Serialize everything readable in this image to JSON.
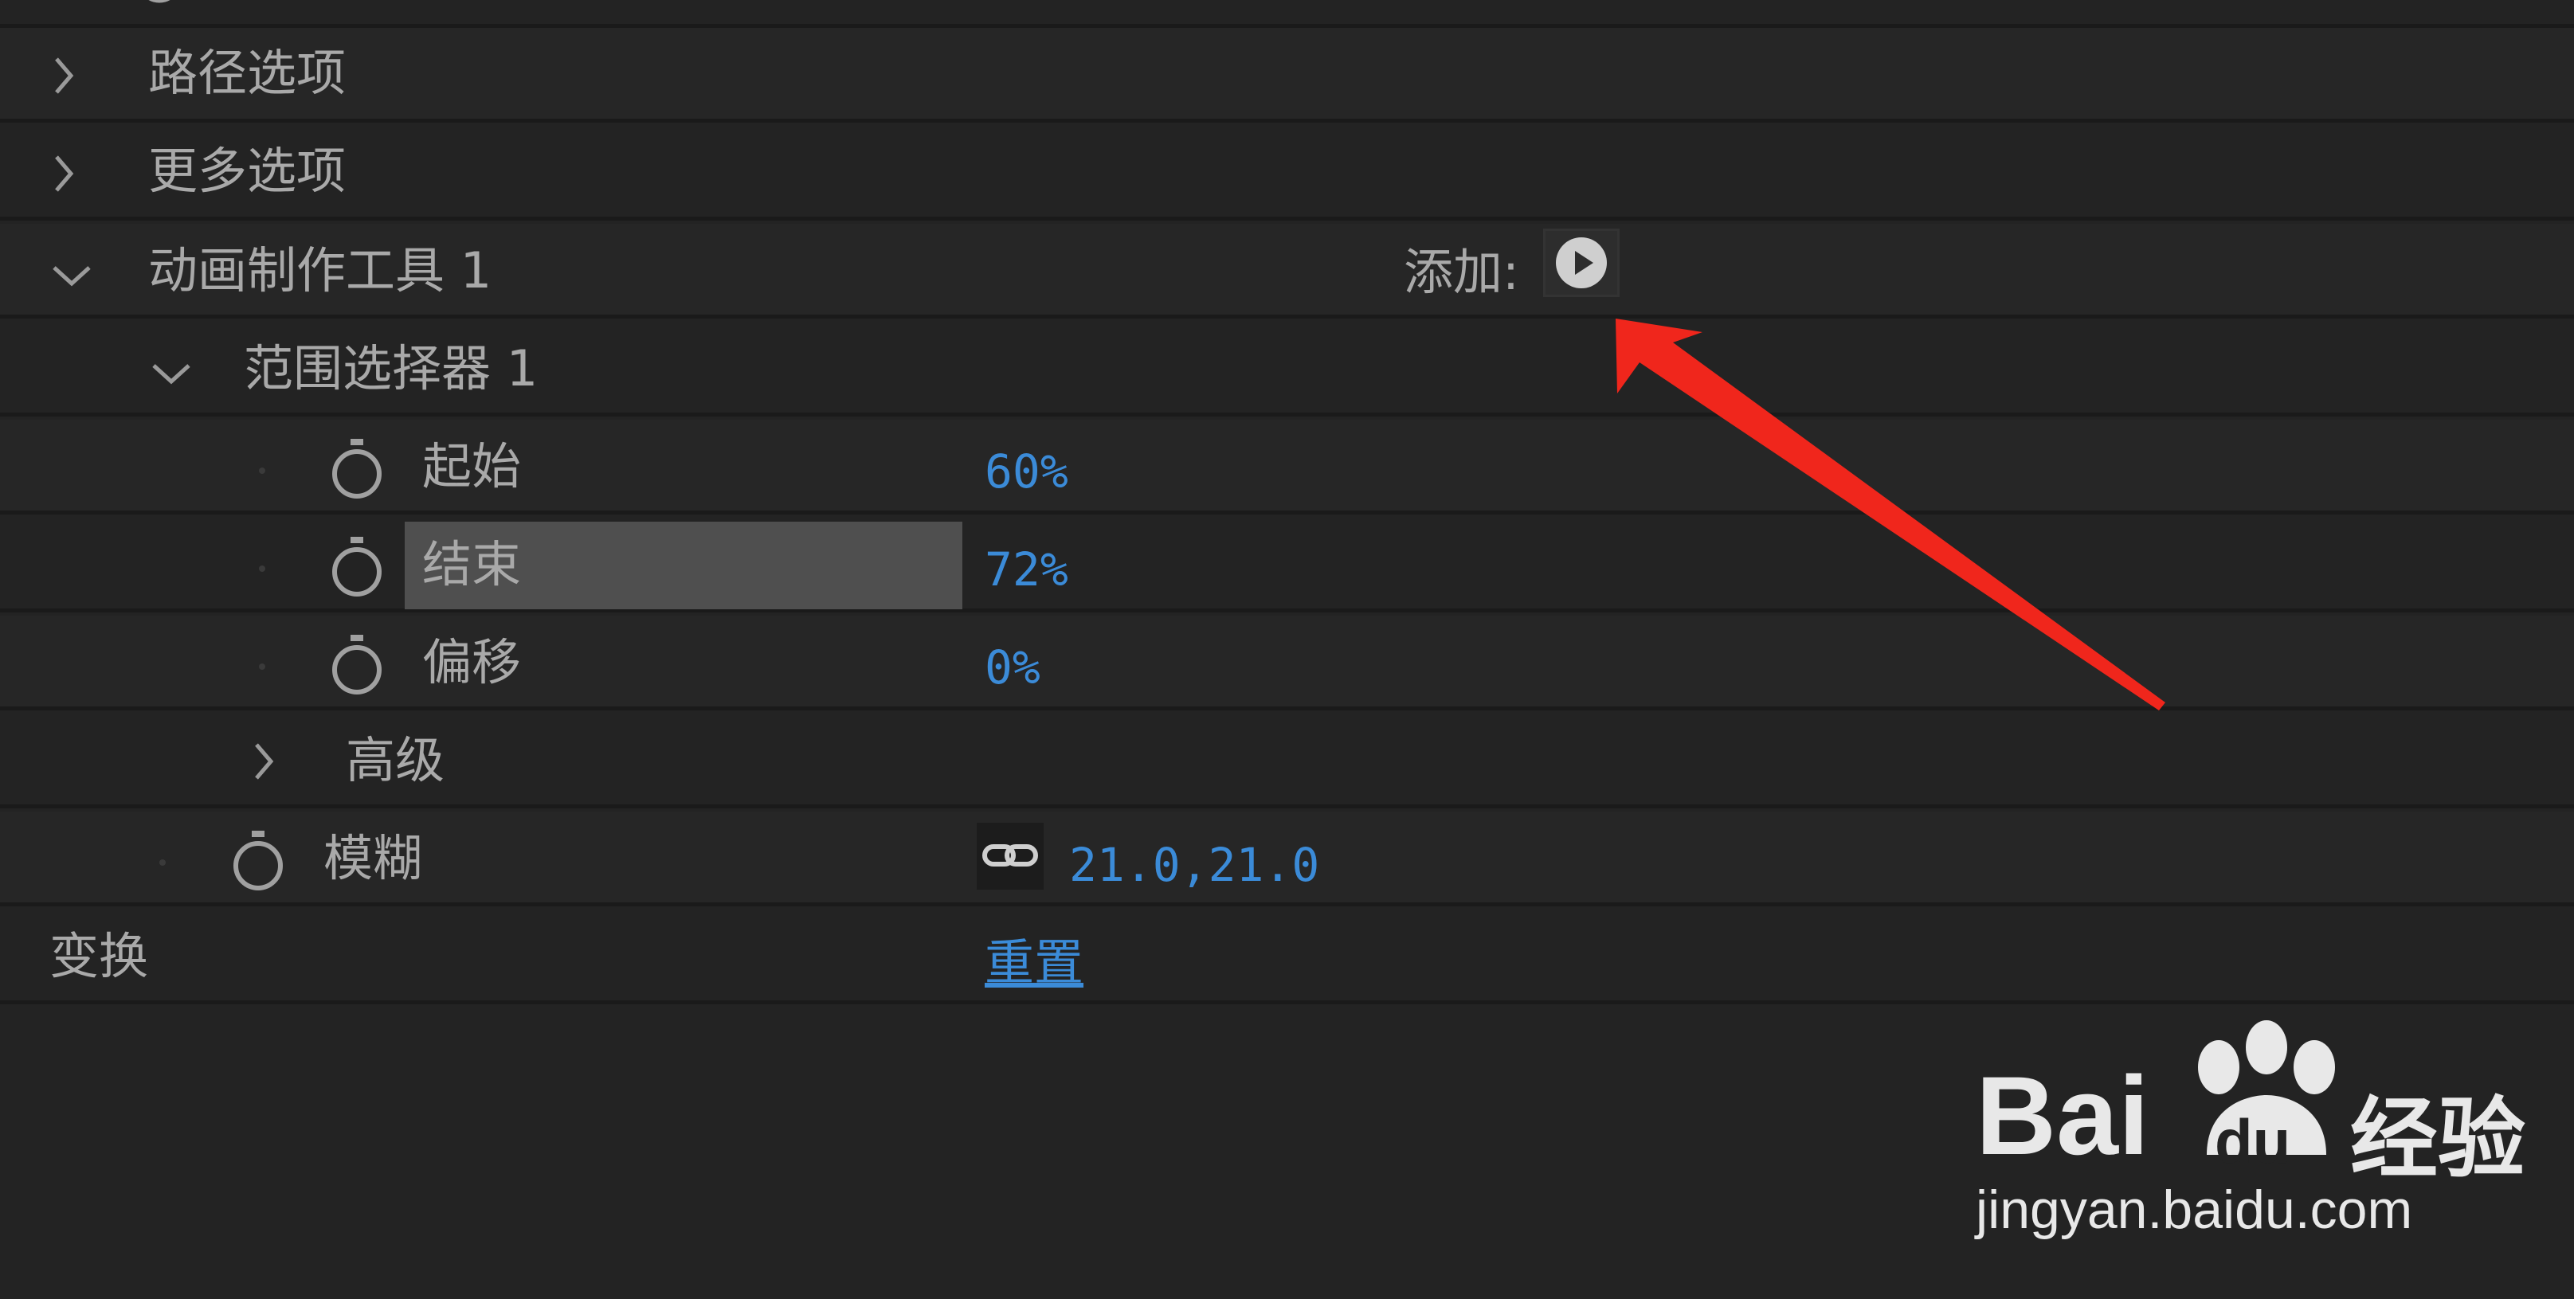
{
  "panel": {
    "rows": [
      {
        "label": "路径选项"
      },
      {
        "label": "更多选项"
      },
      {
        "label": "动画制作工具 1",
        "add_label": "添加:"
      },
      {
        "label": "范围选择器 1"
      },
      {
        "label": "起始",
        "value": "60%"
      },
      {
        "label": "结束",
        "value": "72%"
      },
      {
        "label": "偏移",
        "value": "0%"
      },
      {
        "label": "高级"
      },
      {
        "label": "模糊",
        "value": "21.0,21.0"
      },
      {
        "label": "变换",
        "value": "重置"
      }
    ]
  },
  "icons": {
    "expand": "chevron-right-icon",
    "collapse": "chevron-down-icon",
    "stopwatch": "stopwatch-icon",
    "play": "play-circle-icon",
    "link": "link-icon",
    "arrow": "red-arrow-annotation"
  },
  "colors": {
    "background": "#232323",
    "value_blue": "#3b8bd8",
    "highlight": "#4f4f4f",
    "annotation_red": "#f0261c"
  },
  "watermark": {
    "brand": "Bai",
    "brand2": "du",
    "suffix": "经验",
    "url": "jingyan.baidu.com"
  }
}
